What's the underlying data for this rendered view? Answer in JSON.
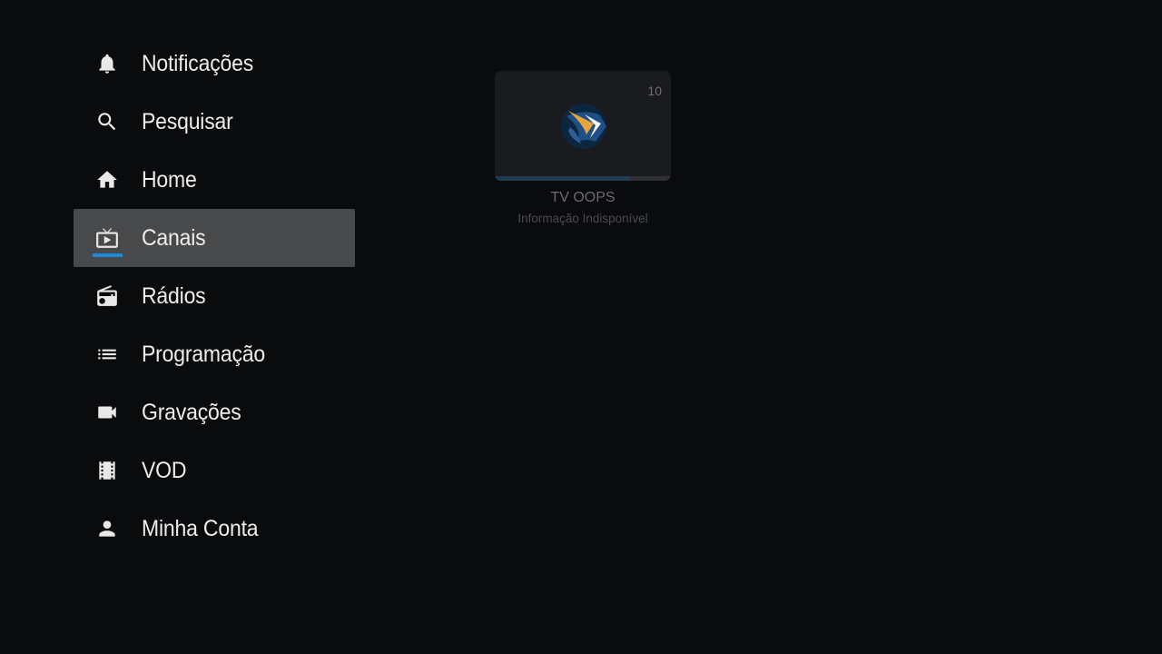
{
  "sidebar": {
    "items": [
      {
        "label": "Notificações",
        "icon": "bell-icon"
      },
      {
        "label": "Pesquisar",
        "icon": "search-icon"
      },
      {
        "label": "Home",
        "icon": "home-icon"
      },
      {
        "label": "Canais",
        "icon": "tv-icon",
        "selected": true
      },
      {
        "label": "Rádios",
        "icon": "radio-icon"
      },
      {
        "label": "Programação",
        "icon": "list-icon"
      },
      {
        "label": "Gravações",
        "icon": "videocam-icon"
      },
      {
        "label": "VOD",
        "icon": "film-icon"
      },
      {
        "label": "Minha Conta",
        "icon": "person-icon"
      }
    ],
    "selected_accent": "#1e8ad6",
    "selected_background": "#48494b"
  },
  "channel": {
    "number": "10",
    "name": "TV OOPS",
    "info": "Informação Indisponível",
    "progress": 0.77,
    "logo_icon": "channel-logo-icon"
  }
}
